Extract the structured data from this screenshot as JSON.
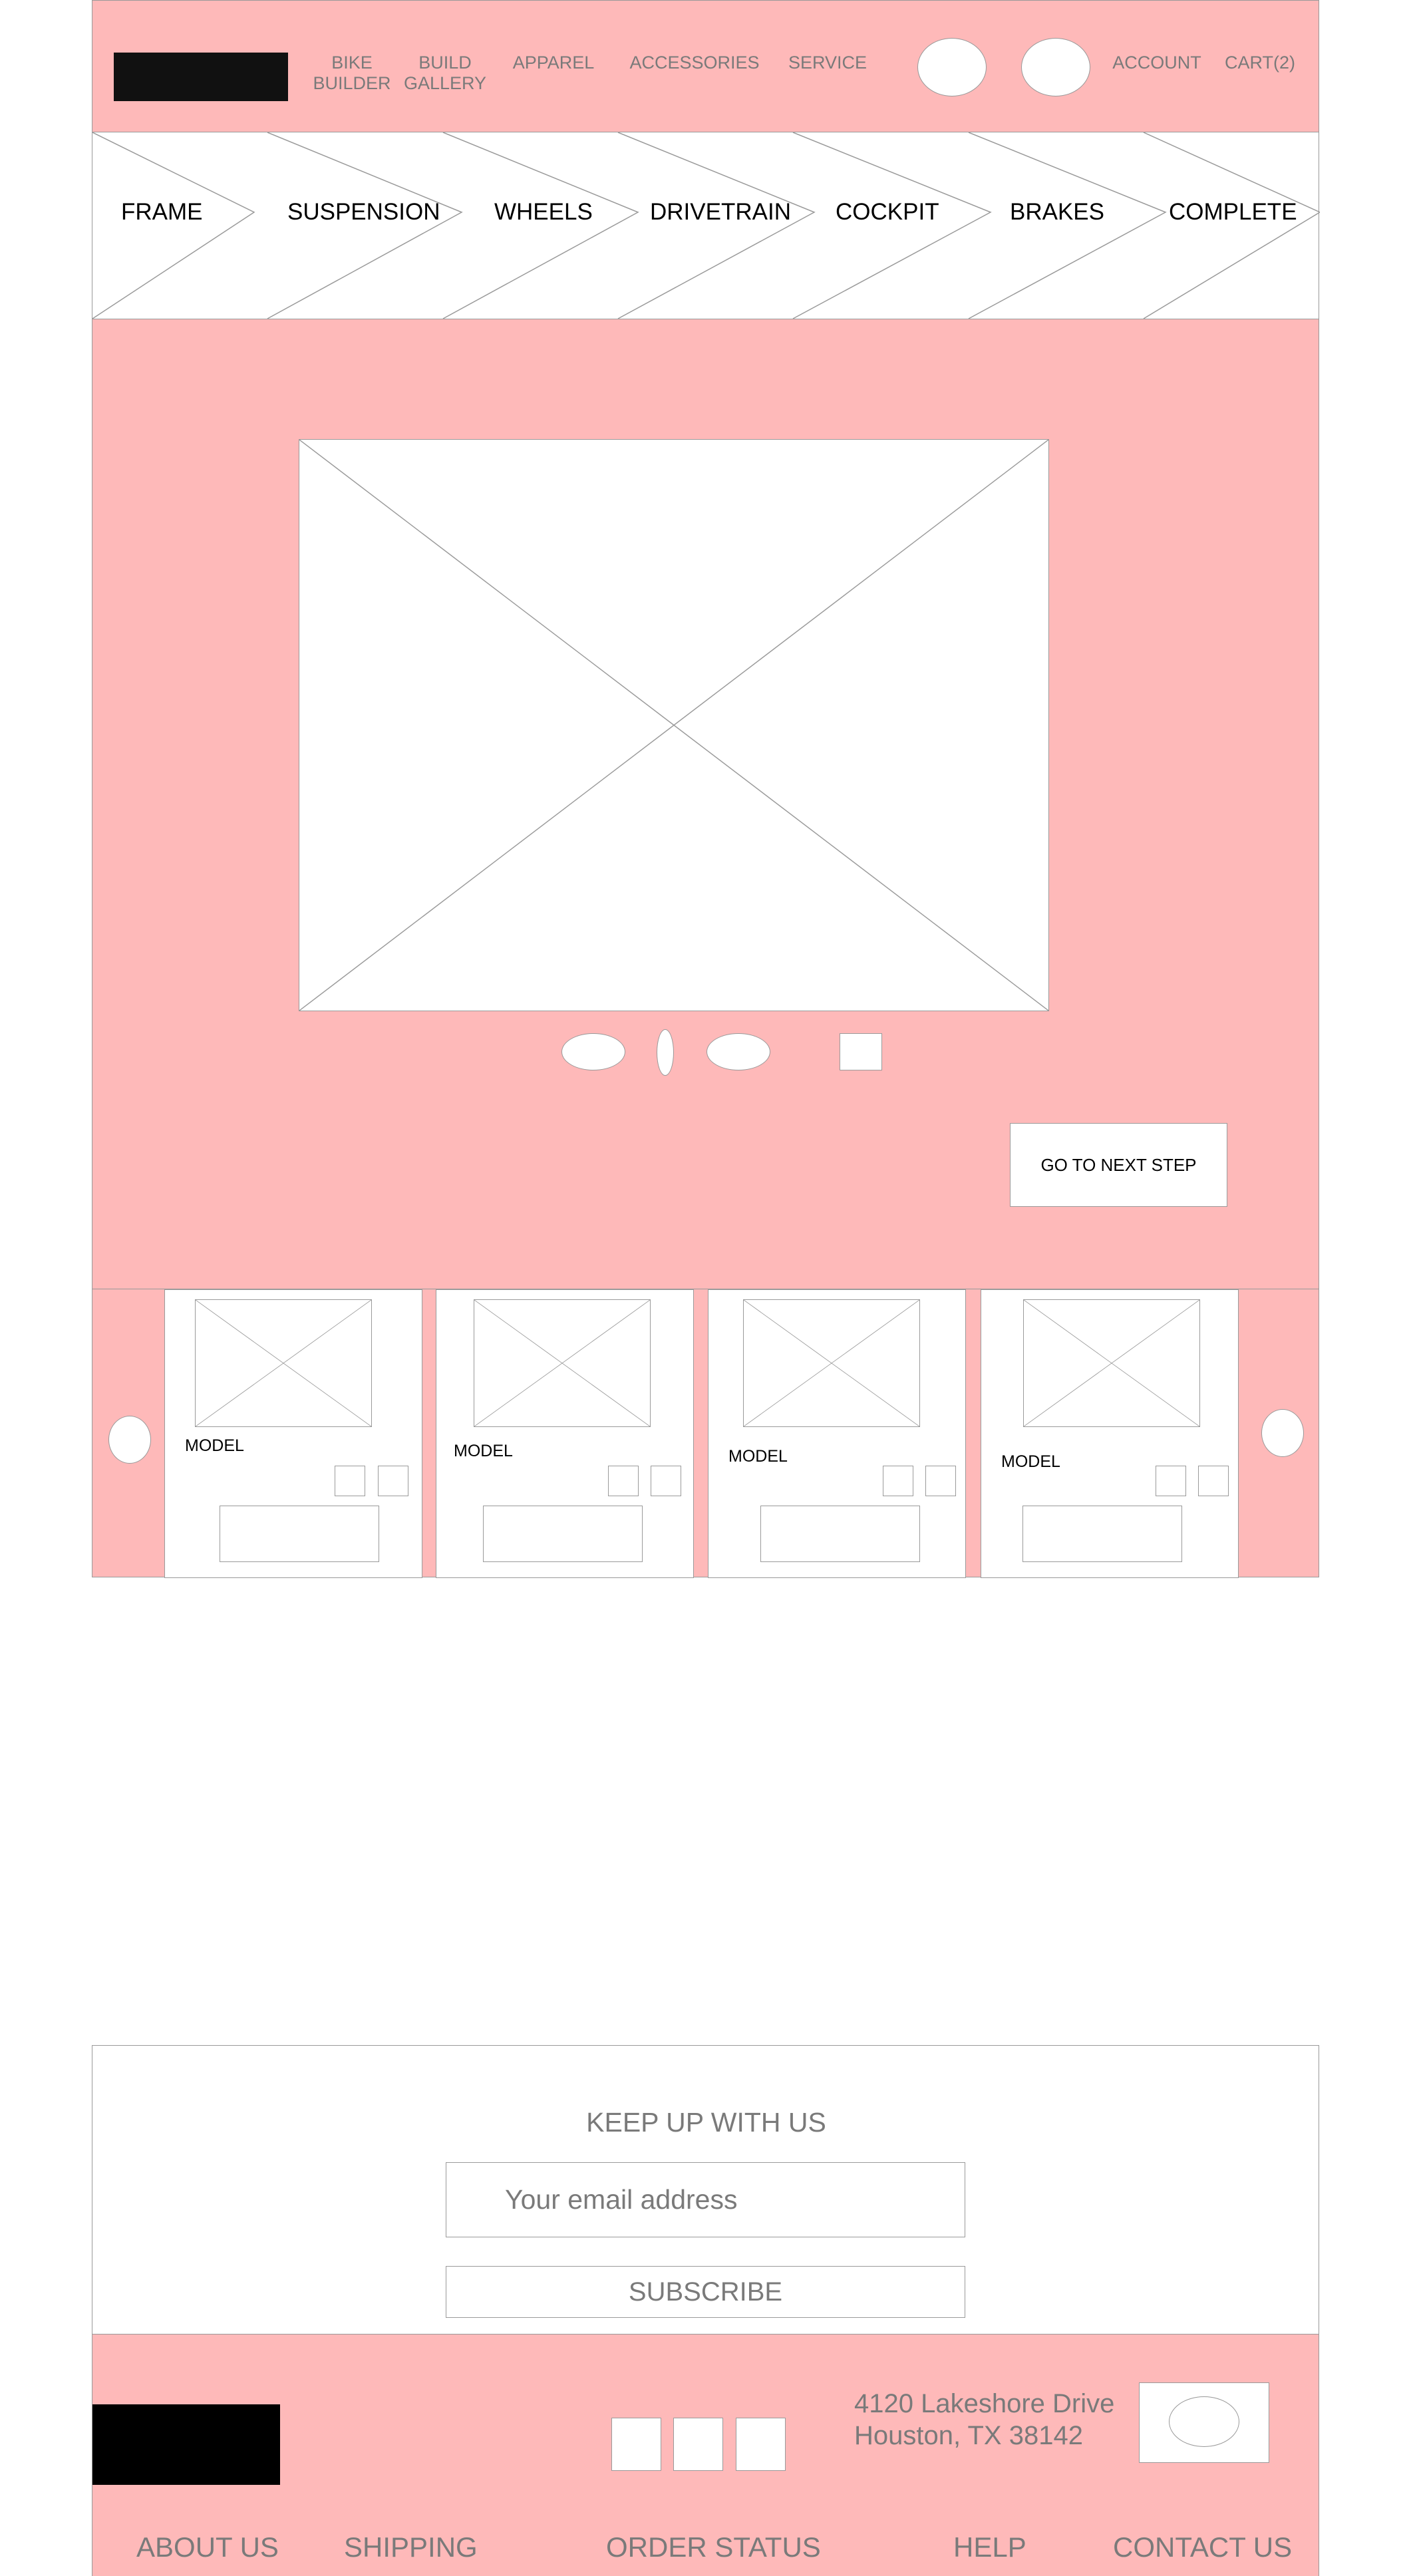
{
  "header": {
    "nav": [
      {
        "id": "bike-builder",
        "label": "BIKE\nBUILDER"
      },
      {
        "id": "build-gallery",
        "label": "BUILD\nGALLERY"
      },
      {
        "id": "apparel",
        "label": "APPAREL"
      },
      {
        "id": "accessories",
        "label": "ACCESSORIES"
      },
      {
        "id": "service",
        "label": "SERVICE"
      }
    ],
    "account_label": "ACCOUNT",
    "cart_label": "CART(2)"
  },
  "steps": [
    "FRAME",
    "SUSPENSION",
    "WHEELS",
    "DRIVETRAIN",
    "COCKPIT",
    "BRAKES",
    "COMPLETE"
  ],
  "builder": {
    "next_step_label": "GO TO NEXT STEP"
  },
  "products": [
    {
      "label": "MODEL"
    },
    {
      "label": "MODEL"
    },
    {
      "label": "MODEL"
    },
    {
      "label": "MODEL"
    }
  ],
  "newsletter": {
    "title": "KEEP UP WITH US",
    "email_placeholder": "Your email address",
    "subscribe_label": "SUBSCRIBE"
  },
  "footer": {
    "address_line1": "4120 Lakeshore Drive",
    "address_line2": "Houston, TX 38142",
    "links": [
      "ABOUT US",
      "SHIPPING",
      "ORDER STATUS",
      "HELP",
      "CONTACT US"
    ]
  },
  "colors": {
    "accent_pink": "#feb9b9",
    "logo_black": "#111111",
    "wireframe_line": "#9a9a9a"
  }
}
